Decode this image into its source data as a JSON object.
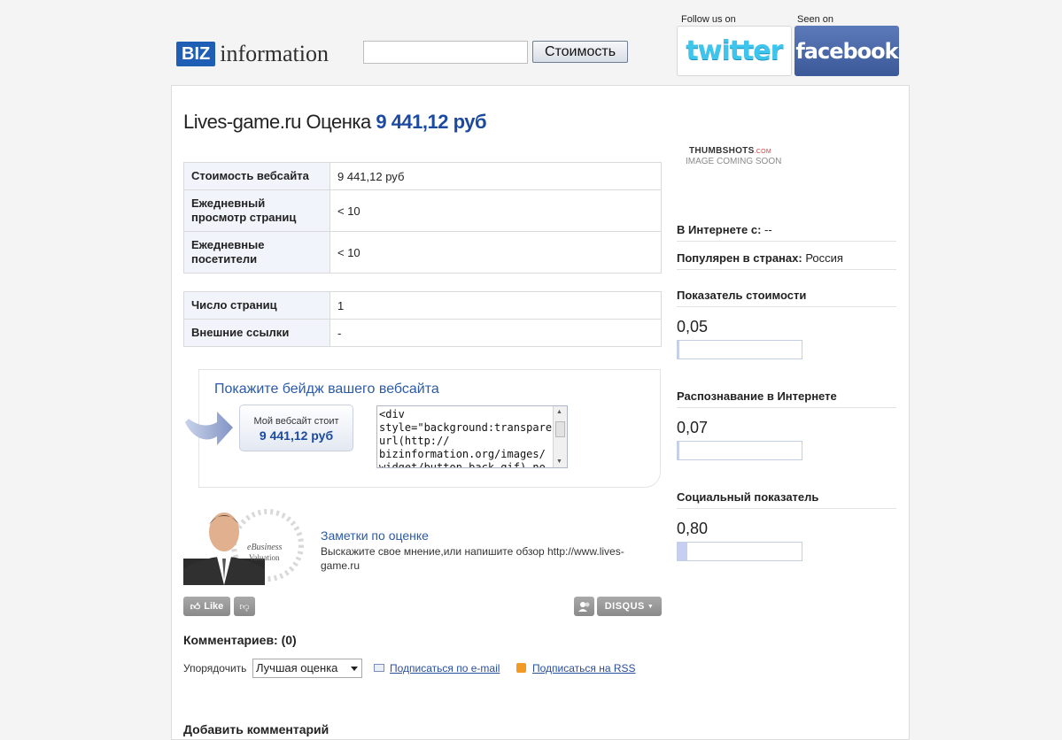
{
  "header": {
    "logo_biz": "BIZ",
    "logo_info": "information",
    "search_value": "",
    "search_button": "Стоимость",
    "follow_label": "Follow us on",
    "seen_label": "Seen on",
    "twitter": "twitter",
    "facebook": "facebook"
  },
  "main": {
    "site": "Lives-game.ru",
    "title_word": "Оценка",
    "valuation": "9 441,12 руб",
    "stats1": [
      {
        "key": "Стоимость вебсайта",
        "value": "9 441,12 руб"
      },
      {
        "key": "Ежедневный просмотр страниц",
        "value": "< 10"
      },
      {
        "key": "Ежедневные посетители",
        "value": "< 10"
      }
    ],
    "stats2": [
      {
        "key": "Число страниц",
        "value": "1"
      },
      {
        "key": "Внешние ссылки",
        "value": "-"
      }
    ],
    "badge": {
      "heading": "Покажите бейдж вашего вебсайта",
      "btn_line1": "Мой вебсайт стоит",
      "btn_line2": "9 441,12 руб",
      "code": "<div\nstyle=\"background:transparen\nurl(http://\nbizinformation.org/images/\nwidget/button-back.gif) no"
    },
    "notes": {
      "person_caption_1": "eBusiness",
      "person_caption_2": "Valuation",
      "title": "Заметки по оценке",
      "text": "Выскажите свое мнение,или напишите обзор http://www.lives-game.ru"
    },
    "disqus": {
      "like": "Like",
      "brand": "DISQUS",
      "comments_title": "Комментариев: (0)",
      "sort_label": "Упорядочить",
      "sort_value": "Лучшая оценка",
      "subscribe_email": "Подписаться по e-mail",
      "subscribe_rss": "Подписаться на RSS",
      "add_comment": "Добавить комментарий"
    }
  },
  "sidebar": {
    "thumbshots": "THUMBSHOTS",
    "thumbshots_com": ".COM",
    "image_soon": "IMAGE COMING SOON",
    "online_since_label": "В Интернете с:",
    "online_since_value": "--",
    "popular_label": "Популярен в странах:",
    "popular_value": "Россия",
    "metrics": [
      {
        "label": "Показатель стоимости",
        "value": "0,05",
        "fill": 0.01
      },
      {
        "label": "Распознавание в Интернете",
        "value": "0,07",
        "fill": 0.01
      },
      {
        "label": "Социальный показатель",
        "value": "0,80",
        "fill": 0.08
      }
    ]
  }
}
